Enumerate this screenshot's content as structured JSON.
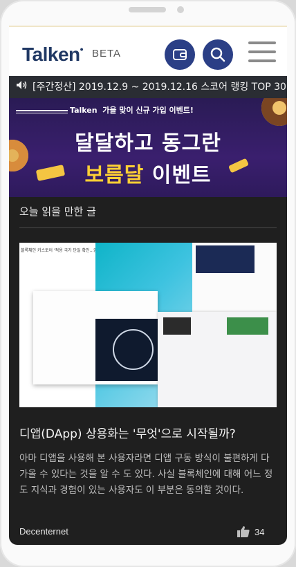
{
  "header": {
    "logo_text": "Talken",
    "badge": "BETA",
    "wallet_icon": "wallet-icon",
    "search_icon": "search-icon",
    "menu_icon": "hamburger-menu-icon",
    "brand_color": "#2b3f86"
  },
  "ticker": {
    "text": "[주간정산] 2019.12.9 ~ 2019.12.16 스코어 랭킹 TOP 30..."
  },
  "banner": {
    "brand": "Talken",
    "subtitle": "가을 맞이 신규 가입 이벤트!",
    "title_line1": "달달하고 동그란",
    "title_line2_highlight": "보름달",
    "title_line2_rest": " 이벤트"
  },
  "section": {
    "title": "오늘 읽을 만한 글"
  },
  "article": {
    "thumbnail_title": "블록체인 키스토어 '적용 국가 단일 확인...앱스토어",
    "title": "디앱(DApp) 상용화는 '무엇'으로 시작될까?",
    "body": "아마 디앱을 사용해 본 사용자라면 디앱 구동 방식이 불편하게 다가올 수 있다는 것을 알 수 도 있다. 사실 블록체인에 대해 어느 정도 지식과 경험이 있는 사용자도 이 부분은 동의할 것이다.",
    "source": "Decenternet",
    "likes": "34"
  }
}
